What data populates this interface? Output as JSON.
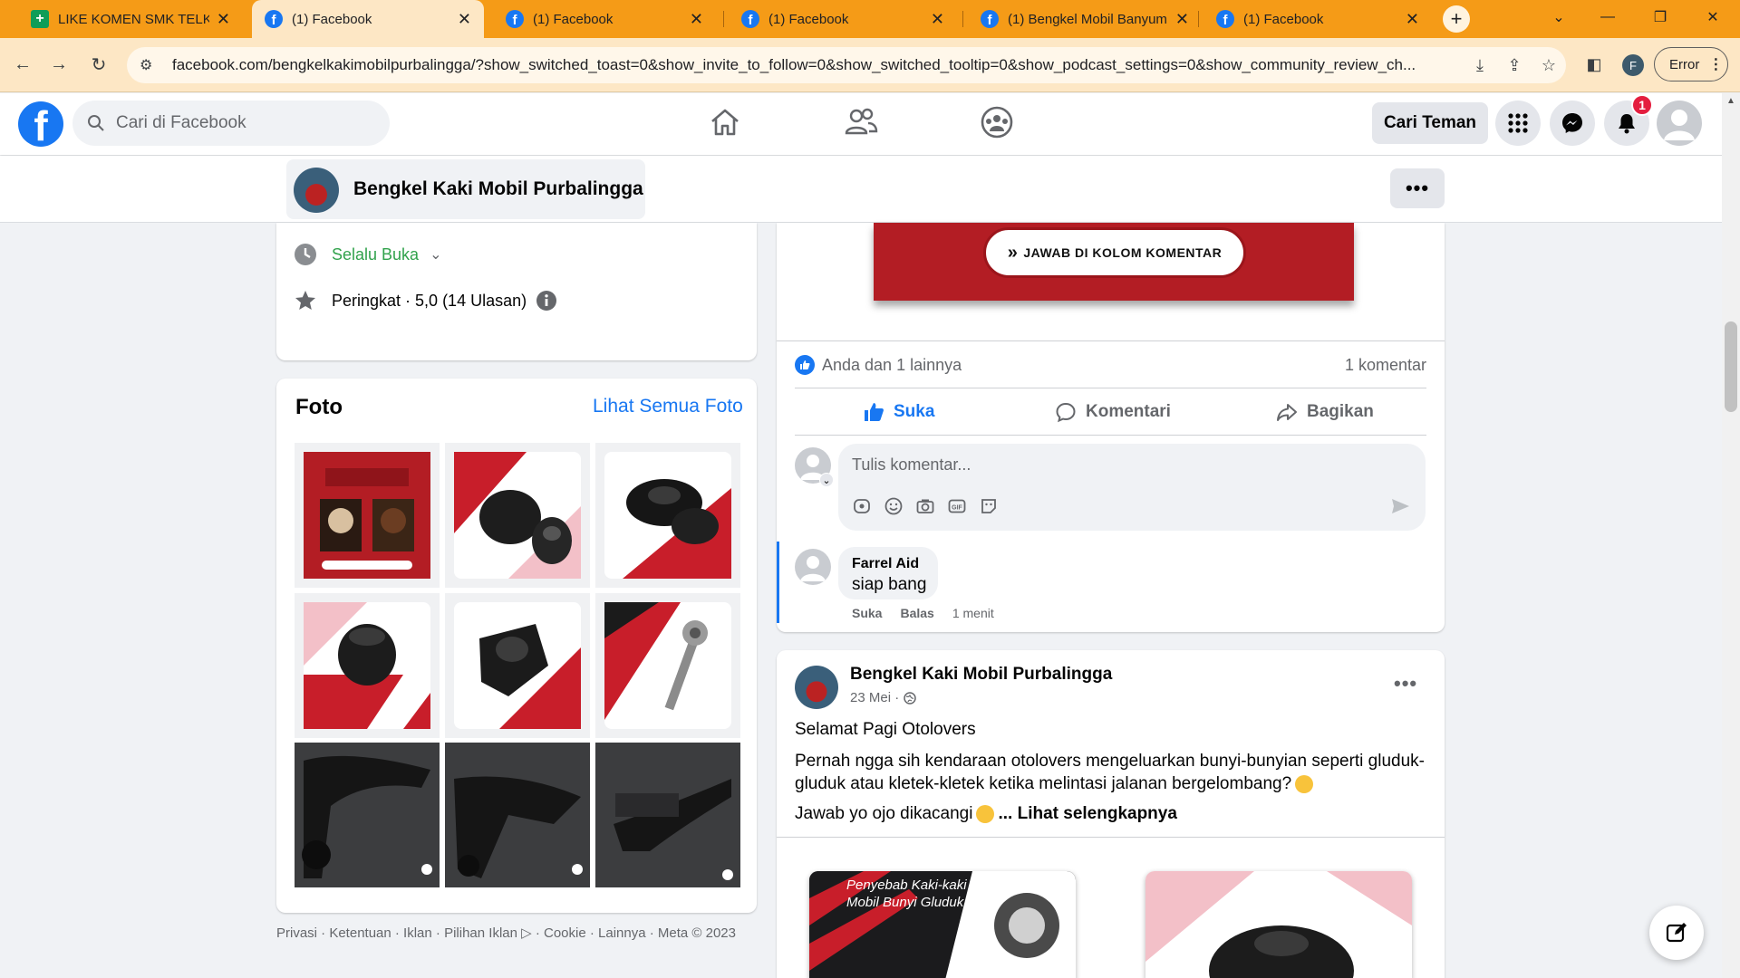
{
  "browser": {
    "tabs": [
      {
        "title": "LIKE KOMEN SMK TELKOM",
        "icon": "sheets-icon"
      },
      {
        "title": "(1) Facebook",
        "icon": "facebook-icon"
      },
      {
        "title": "(1) Facebook",
        "icon": "facebook-icon"
      },
      {
        "title": "(1) Facebook",
        "icon": "facebook-icon"
      },
      {
        "title": "(1) Bengkel Mobil Banyum",
        "icon": "facebook-icon"
      },
      {
        "title": "(1) Facebook",
        "icon": "facebook-icon"
      }
    ],
    "active_tab": 1,
    "url": "facebook.com/bengkelkakimobilpurbalingga/?show_switched_toast=0&show_invite_to_follow=0&show_switched_tooltip=0&show_podcast_settings=0&show_community_review_ch...",
    "profile_initial": "F",
    "error_label": "Error",
    "tab_color": "#f59b17"
  },
  "fb": {
    "logo": "f",
    "search_placeholder": "Cari di Facebook",
    "cari_teman": "Cari Teman",
    "notif_count": "1",
    "brand_color": "#1877f2"
  },
  "page": {
    "name": "Bengkel Kaki Mobil Purbalingga",
    "hours": "Selalu Buka",
    "rating": "Peringkat · 5,0 (14 Ulasan)"
  },
  "foto": {
    "title": "Foto",
    "see_all": "Lihat Semua Foto"
  },
  "footer": {
    "links": "Privasi · Ketentuan · Iklan · Pilihan Iklan ▷ · Cookie · Lainnya · Meta © 2023"
  },
  "post1": {
    "banner_text": "JAWAB DI KOLOM KOMENTAR",
    "reactions": "Anda dan 1 lainnya",
    "comment_count": "1 komentar",
    "actions": {
      "like": "Suka",
      "comment": "Komentari",
      "share": "Bagikan"
    },
    "comment_placeholder": "Tulis komentar...",
    "comment": {
      "author": "Farrel Aid",
      "text": "siap bang",
      "like": "Suka",
      "reply": "Balas",
      "time": "1 menit"
    }
  },
  "post2": {
    "author": "Bengkel Kaki Mobil Purbalingga",
    "date": "23 Mei ·",
    "line1": "Selamat Pagi Otolovers",
    "line2": "Pernah ngga sih kendaraan otolovers mengeluarkan bunyi-bunyian seperti gluduk-gluduk atau kletek-kletek ketika melintasi jalanan bergelombang?",
    "line3": "Jawab yo ojo dikacangi",
    "see_more": "... Lihat selengkapnya",
    "media_caption": "Penyebab Kaki-kaki Mobil Bunyi Gluduk"
  }
}
